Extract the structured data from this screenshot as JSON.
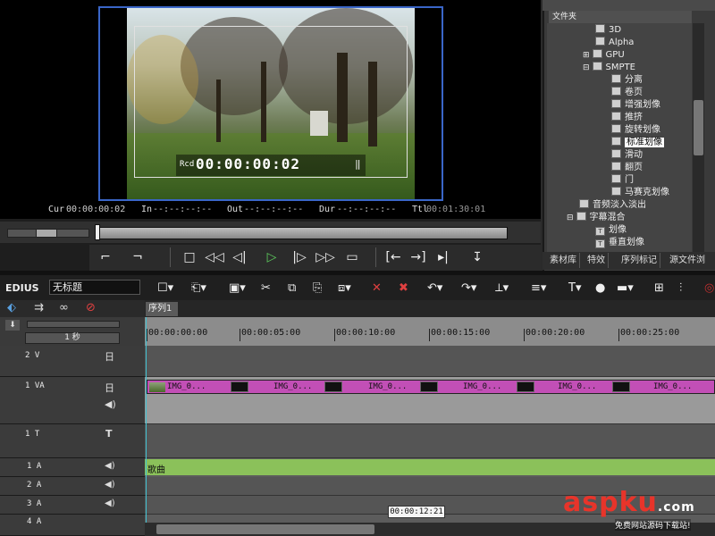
{
  "preview": {
    "overlay_label": "Rcd",
    "overlay_tc": "00:00:00:02",
    "overlay_mark": "‖",
    "cur_label": "Cur",
    "cur_value": "00:00:00:02",
    "in_label": "In",
    "in_value": "--:--:--:--",
    "out_label": "Out",
    "out_value": "--:--:--:--",
    "dur_label": "Dur",
    "dur_value": "--:--:--:--",
    "ttl_label": "Ttl",
    "ttl_value": "00:01:30:01"
  },
  "library": {
    "header": "文件夹",
    "items": [
      {
        "label": "3D"
      },
      {
        "label": "Alpha"
      },
      {
        "label": "GPU"
      },
      {
        "label": "SMPTE"
      },
      {
        "label": "分离"
      },
      {
        "label": "卷页"
      },
      {
        "label": "增强划像"
      },
      {
        "label": "推挤"
      },
      {
        "label": "旋转划像"
      },
      {
        "label": "标准划像"
      },
      {
        "label": "滑动"
      },
      {
        "label": "翻页"
      },
      {
        "label": "门"
      },
      {
        "label": "马赛克划像"
      },
      {
        "label": "音频淡入淡出"
      },
      {
        "label": "字幕混合"
      },
      {
        "label": "划像"
      },
      {
        "label": "垂直划像"
      }
    ],
    "tabs": [
      "素材库",
      "特效",
      "序列标记",
      "源文件浏"
    ]
  },
  "editor": {
    "logo": "EDIUS",
    "project_title": "无标题",
    "sequence_tab": "序列1",
    "zoom_label": "1 秒",
    "ruler": [
      "00:00:00:00",
      "00:00:05:00",
      "00:00:10:00",
      "00:00:15:00",
      "00:00:20:00",
      "00:00:25:00"
    ],
    "tracks": {
      "v2": "2 V",
      "va1": "1 VA",
      "t1": "1 T",
      "a1": "1 A",
      "a2": "2 A",
      "a3": "3 A",
      "a4": "4 A"
    },
    "clip_label": "IMG_0...",
    "audio_clip": "歌曲",
    "tooltip": "00:00:12:21"
  },
  "watermark": {
    "main": "aspku",
    "suffix": ".com",
    "sub": "免费网站源码下载站!"
  }
}
